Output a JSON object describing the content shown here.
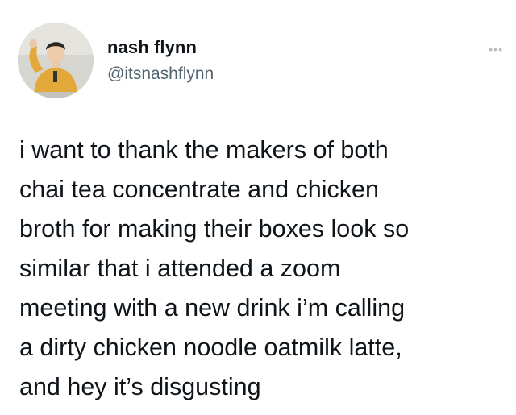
{
  "tweet": {
    "author": {
      "display_name": "nash flynn",
      "handle": "@itsnashflynn",
      "avatar_icon": "profile-photo-avatar"
    },
    "more_icon": "more-options-icon",
    "more_label": "•••",
    "text_lines": [
      "i want to thank the makers of both",
      "chai tea concentrate and chicken",
      "broth for making their boxes look so",
      "similar that i attended a zoom",
      "meeting with a new drink i’m calling",
      "a dirty chicken noodle oatmilk latte,",
      "and hey it’s disgusting"
    ]
  },
  "colors": {
    "background": "#ffffff",
    "text": "#0f1419",
    "secondary_text": "#536471",
    "avatar_shirt": "#e2a83a"
  }
}
